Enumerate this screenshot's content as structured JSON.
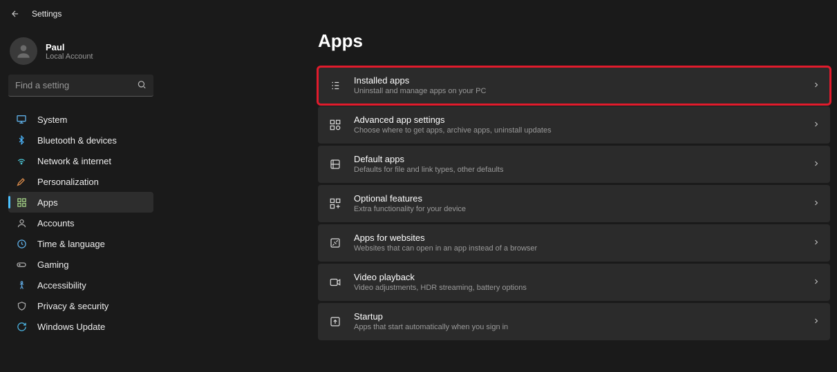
{
  "app": {
    "title": "Settings"
  },
  "account": {
    "name": "Paul",
    "sub": "Local Account"
  },
  "search": {
    "placeholder": "Find a setting"
  },
  "sidebar": {
    "items": [
      {
        "id": "system",
        "label": "System"
      },
      {
        "id": "bluetooth",
        "label": "Bluetooth & devices"
      },
      {
        "id": "network",
        "label": "Network & internet"
      },
      {
        "id": "personalization",
        "label": "Personalization"
      },
      {
        "id": "apps",
        "label": "Apps"
      },
      {
        "id": "accounts",
        "label": "Accounts"
      },
      {
        "id": "time",
        "label": "Time & language"
      },
      {
        "id": "gaming",
        "label": "Gaming"
      },
      {
        "id": "accessibility",
        "label": "Accessibility"
      },
      {
        "id": "privacy",
        "label": "Privacy & security"
      },
      {
        "id": "update",
        "label": "Windows Update"
      }
    ]
  },
  "page": {
    "title": "Apps"
  },
  "cards": [
    {
      "id": "installed-apps",
      "title": "Installed apps",
      "sub": "Uninstall and manage apps on your PC",
      "highlight": true
    },
    {
      "id": "advanced-app-settings",
      "title": "Advanced app settings",
      "sub": "Choose where to get apps, archive apps, uninstall updates"
    },
    {
      "id": "default-apps",
      "title": "Default apps",
      "sub": "Defaults for file and link types, other defaults"
    },
    {
      "id": "optional-features",
      "title": "Optional features",
      "sub": "Extra functionality for your device"
    },
    {
      "id": "apps-for-websites",
      "title": "Apps for websites",
      "sub": "Websites that can open in an app instead of a browser"
    },
    {
      "id": "video-playback",
      "title": "Video playback",
      "sub": "Video adjustments, HDR streaming, battery options"
    },
    {
      "id": "startup",
      "title": "Startup",
      "sub": "Apps that start automatically when you sign in"
    }
  ]
}
